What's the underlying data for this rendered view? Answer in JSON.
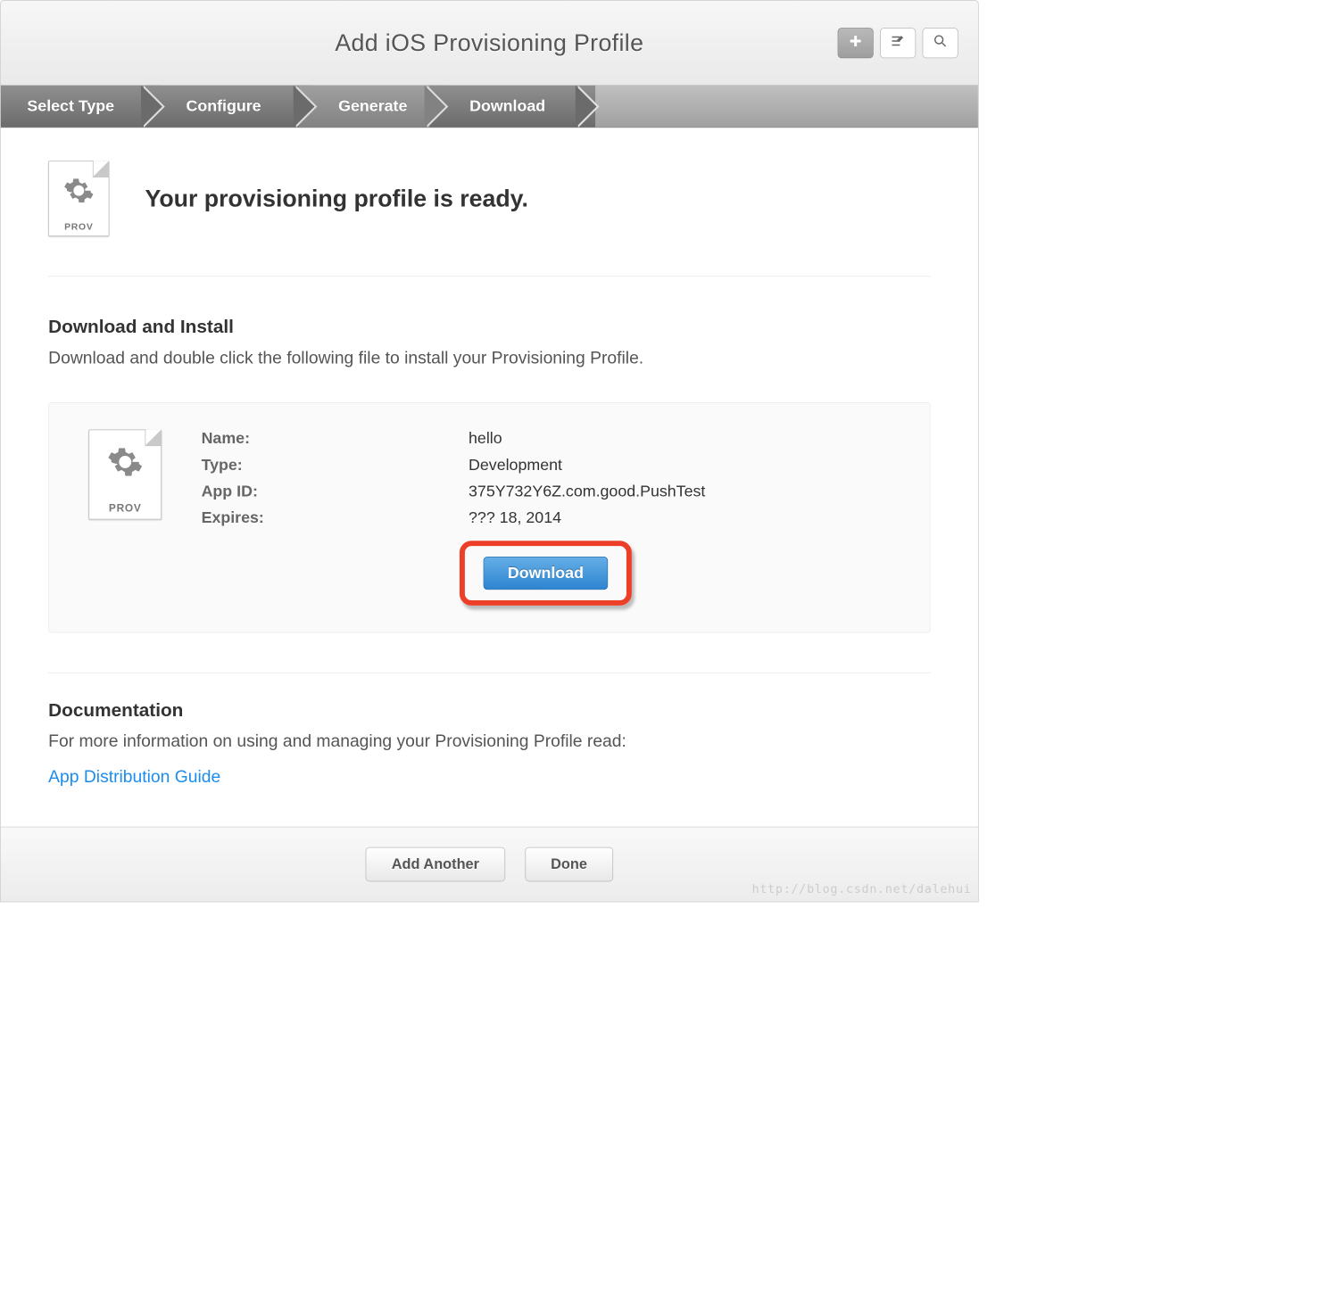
{
  "header": {
    "title": "Add iOS Provisioning Profile"
  },
  "steps": {
    "s1": "Select Type",
    "s2": "Configure",
    "s3": "Generate",
    "s4": "Download"
  },
  "hero": {
    "icon_caption": "PROV",
    "title": "Your provisioning profile is ready."
  },
  "download_section": {
    "title": "Download and Install",
    "desc": "Download and double click the following file to install your Provisioning Profile.",
    "icon_caption": "PROV",
    "labels": {
      "name": "Name:",
      "type": "Type:",
      "appid": "App ID:",
      "expires": "Expires:"
    },
    "values": {
      "name": "hello",
      "type": "Development",
      "appid": "375Y732Y6Z.com.good.PushTest",
      "expires": "??? 18, 2014"
    },
    "button": "Download"
  },
  "documentation": {
    "title": "Documentation",
    "desc": "For more information on using and managing your Provisioning Profile read:",
    "link": "App Distribution Guide"
  },
  "footer": {
    "add_another": "Add Another",
    "done": "Done"
  },
  "watermark": "http://blog.csdn.net/dalehui"
}
